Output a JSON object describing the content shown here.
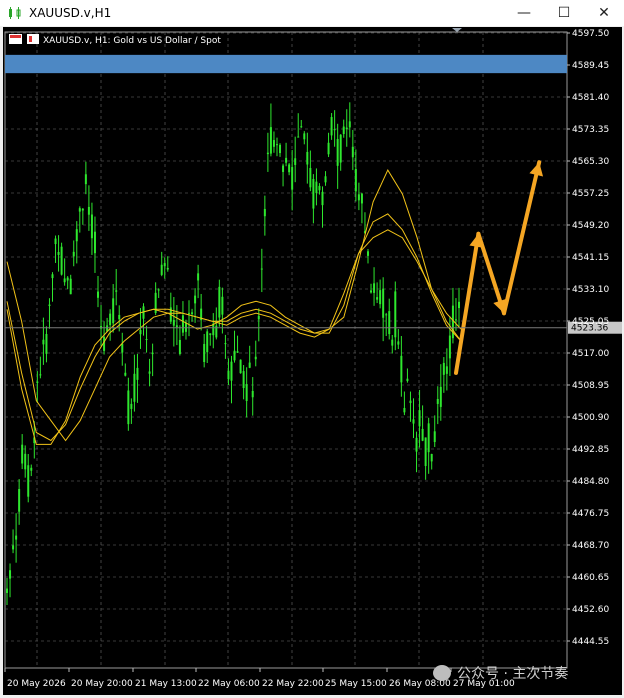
{
  "window": {
    "title": "XAUUSD.v,H1",
    "minimize": "—",
    "maximize": "☐",
    "close": "✕"
  },
  "chart_header": {
    "symbol_line": "XAUUSD.v, H1:  Gold vs US Dollar / Spot"
  },
  "colors": {
    "background": "#000000",
    "candles": "#2ee82e",
    "ma": "#f2c318",
    "highlight_band": "#4d88c4",
    "arrows": "#f5a623",
    "current_price_line": "#7a7a7a"
  },
  "watermark": {
    "text": "公众号 · 主次节奏"
  },
  "chart_data": {
    "type": "candlestick",
    "symbol": "XAUUSD.v",
    "timeframe": "H1",
    "title": "Gold vs US Dollar / Spot",
    "y_ticks": [
      "4597.50",
      "4589.45",
      "4581.40",
      "4573.35",
      "4565.30",
      "4557.25",
      "4549.20",
      "4541.15",
      "4533.10",
      "4525.05",
      "4517.00",
      "4508.95",
      "4500.90",
      "4492.85",
      "4484.80",
      "4476.75",
      "4468.70",
      "4460.65",
      "4452.60",
      "4444.55"
    ],
    "ylim": [
      4444.55,
      4597.5
    ],
    "x_ticks": [
      "20 May 2026",
      "20 May 20:00",
      "21 May 13:00",
      "22 May 06:00",
      "22 May 22:00",
      "25 May 15:00",
      "26 May 08:00",
      "27 May 01:00"
    ],
    "current_price": "4523.36",
    "highlight_band": [
      4587.4,
      4592.0
    ],
    "close_path": [
      4460,
      4470,
      4492,
      4484,
      4512,
      4520,
      4546,
      4538,
      4535,
      4552,
      4560,
      4542,
      4519,
      4525,
      4533,
      4508,
      4502,
      4530,
      4512,
      4531,
      4541,
      4527,
      4521,
      4530,
      4536,
      4517,
      4523,
      4527,
      4515,
      4519,
      4512,
      4508,
      4531,
      4569,
      4573,
      4565,
      4560,
      4573,
      4563,
      4560,
      4557,
      4573,
      4567,
      4576,
      4561,
      4549,
      4532,
      4534,
      4521,
      4527,
      4509,
      4502,
      4498,
      4493,
      4495,
      4510,
      4521,
      4531
    ],
    "ma_series": [
      {
        "values": [
          4540,
          4525,
          4505,
          4500,
          4495,
          4500,
          4508,
          4516,
          4520,
          4523,
          4526,
          4527,
          4525,
          4523,
          4524,
          4526,
          4529,
          4530,
          4529,
          4526,
          4524,
          4522,
          4523,
          4526,
          4540,
          4555,
          4563,
          4557,
          4546,
          4533,
          4525,
          4520
        ]
      },
      {
        "values": [
          4530,
          4512,
          4497,
          4495,
          4499,
          4508,
          4516,
          4522,
          4525,
          4527,
          4528,
          4528,
          4527,
          4526,
          4525,
          4525,
          4527,
          4528,
          4527,
          4525,
          4523,
          4522,
          4522,
          4529,
          4542,
          4550,
          4552,
          4548,
          4541,
          4532,
          4524,
          4520
        ]
      },
      {
        "values": [
          4528,
          4508,
          4494,
          4494,
          4500,
          4511,
          4519,
          4523,
          4526,
          4527,
          4528,
          4527,
          4527,
          4526,
          4525,
          4524,
          4526,
          4527,
          4526,
          4524,
          4522,
          4521,
          4523,
          4532,
          4542,
          4546,
          4548,
          4546,
          4540,
          4533,
          4527,
          4523
        ]
      }
    ],
    "arrows_path": [
      [
        0.0,
        4512
      ],
      [
        0.14,
        4547
      ],
      [
        0.3,
        4527
      ],
      [
        0.52,
        4565
      ]
    ]
  }
}
